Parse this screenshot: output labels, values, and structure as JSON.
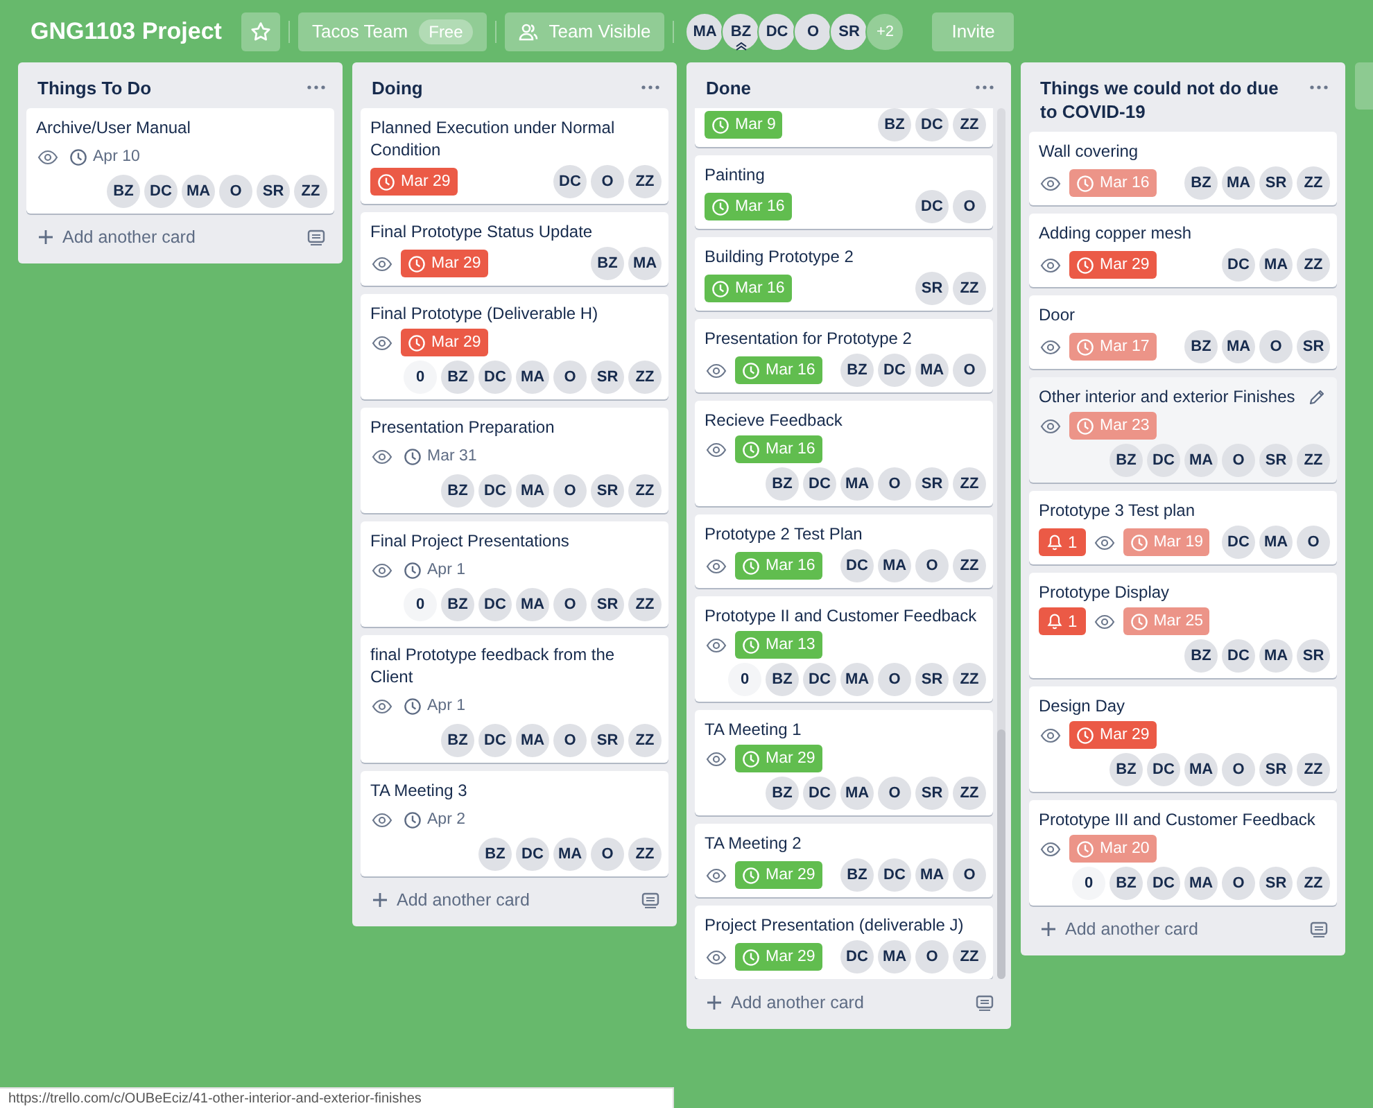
{
  "board": {
    "title": "GNG1103 Project",
    "team": "Tacos Team",
    "plan": "Free",
    "visibility": "Team Visible",
    "members": [
      {
        "initials": "MA",
        "admin": false
      },
      {
        "initials": "BZ",
        "admin": true
      },
      {
        "initials": "DC",
        "admin": false
      },
      {
        "initials": "O",
        "admin": false
      },
      {
        "initials": "SR",
        "admin": false
      }
    ],
    "more_members": "+2",
    "invite": "Invite"
  },
  "lists": [
    {
      "title": "Things To Do",
      "add_card": "Add another card",
      "scrollbar": false,
      "cards": [
        {
          "title": "Archive/User Manual",
          "watching": true,
          "due": {
            "text": "Apr 10",
            "kind": "plain"
          },
          "members": [
            "BZ",
            "DC",
            "MA",
            "O",
            "SR",
            "ZZ"
          ],
          "hovered": false
        }
      ]
    },
    {
      "title": "Doing",
      "add_card": "Add another card",
      "scrollbar": false,
      "cards": [
        {
          "title": "Planned Execution under Normal Condition",
          "watching": false,
          "due": {
            "text": "Mar 29",
            "kind": "overdue"
          },
          "members": [
            "DC",
            "O",
            "ZZ"
          ],
          "hovered": false
        },
        {
          "title": "Final Prototype Status Update",
          "watching": true,
          "due": {
            "text": "Mar 29",
            "kind": "overdue"
          },
          "members": [
            "BZ",
            "MA"
          ],
          "hovered": false
        },
        {
          "title": "Final Prototype (Deliverable H)",
          "watching": true,
          "due": {
            "text": "Mar 29",
            "kind": "overdue"
          },
          "count_badge": "0",
          "members": [
            "BZ",
            "DC",
            "MA",
            "O",
            "SR",
            "ZZ"
          ],
          "hovered": false
        },
        {
          "title": "Presentation Preparation",
          "watching": true,
          "due": {
            "text": "Mar 31",
            "kind": "plain"
          },
          "members": [
            "BZ",
            "DC",
            "MA",
            "O",
            "SR",
            "ZZ"
          ],
          "hovered": false
        },
        {
          "title": "Final Project Presentations",
          "watching": true,
          "due": {
            "text": "Apr 1",
            "kind": "plain"
          },
          "count_badge": "0",
          "members": [
            "BZ",
            "DC",
            "MA",
            "O",
            "SR",
            "ZZ"
          ],
          "hovered": false
        },
        {
          "title": "final Prototype feedback from the Client",
          "watching": true,
          "due": {
            "text": "Apr 1",
            "kind": "plain"
          },
          "members": [
            "BZ",
            "DC",
            "MA",
            "O",
            "SR",
            "ZZ"
          ],
          "hovered": false
        },
        {
          "title": "TA Meeting 3",
          "watching": true,
          "due": {
            "text": "Apr 2",
            "kind": "plain"
          },
          "members": [
            "BZ",
            "DC",
            "MA",
            "O",
            "ZZ"
          ],
          "hovered": false
        }
      ]
    },
    {
      "title": "Done",
      "add_card": "Add another card",
      "scrollbar": true,
      "cards": [
        {
          "watching": false,
          "due": {
            "text": "Mar 9",
            "kind": "complete"
          },
          "members": [
            "BZ",
            "DC",
            "ZZ"
          ],
          "hovered": false
        },
        {
          "title": "Painting",
          "watching": false,
          "due": {
            "text": "Mar 16",
            "kind": "complete"
          },
          "members": [
            "DC",
            "O"
          ],
          "hovered": false
        },
        {
          "title": "Building Prototype 2",
          "watching": false,
          "due": {
            "text": "Mar 16",
            "kind": "complete"
          },
          "members": [
            "SR",
            "ZZ"
          ],
          "hovered": false
        },
        {
          "title": "Presentation for Prototype 2",
          "watching": true,
          "due": {
            "text": "Mar 16",
            "kind": "complete"
          },
          "members": [
            "BZ",
            "DC",
            "MA",
            "O"
          ],
          "hovered": false
        },
        {
          "title": "Recieve Feedback",
          "watching": true,
          "due": {
            "text": "Mar 16",
            "kind": "complete"
          },
          "members": [
            "BZ",
            "DC",
            "MA",
            "O",
            "SR",
            "ZZ"
          ],
          "hovered": false
        },
        {
          "title": "Prototype 2 Test Plan",
          "watching": true,
          "due": {
            "text": "Mar 16",
            "kind": "complete"
          },
          "members": [
            "DC",
            "MA",
            "O",
            "ZZ"
          ],
          "hovered": false
        },
        {
          "title": "Prototype II and Customer Feedback",
          "watching": true,
          "due": {
            "text": "Mar 13",
            "kind": "complete"
          },
          "count_badge": "0",
          "members": [
            "BZ",
            "DC",
            "MA",
            "O",
            "SR",
            "ZZ"
          ],
          "hovered": false
        },
        {
          "title": "TA Meeting 1",
          "watching": true,
          "due": {
            "text": "Mar 29",
            "kind": "complete"
          },
          "members": [
            "BZ",
            "DC",
            "MA",
            "O",
            "SR",
            "ZZ"
          ],
          "hovered": false
        },
        {
          "title": "TA Meeting 2",
          "watching": true,
          "due": {
            "text": "Mar 29",
            "kind": "complete"
          },
          "members": [
            "BZ",
            "DC",
            "MA",
            "O"
          ],
          "hovered": false
        },
        {
          "title": "Project Presentation (deliverable J)",
          "watching": true,
          "due": {
            "text": "Mar 29",
            "kind": "complete"
          },
          "members": [
            "DC",
            "MA",
            "O",
            "ZZ"
          ],
          "hovered": false
        }
      ]
    },
    {
      "title": "Things we could not do due to COVID-19",
      "add_card": "Add another card",
      "scrollbar": false,
      "cards": [
        {
          "title": "Wall covering",
          "watching": true,
          "due": {
            "text": "Mar 16",
            "kind": "overdue_faded"
          },
          "members": [
            "BZ",
            "MA",
            "SR",
            "ZZ"
          ],
          "hovered": false
        },
        {
          "title": "Adding copper mesh",
          "watching": true,
          "due": {
            "text": "Mar 29",
            "kind": "overdue"
          },
          "members": [
            "DC",
            "MA",
            "ZZ"
          ],
          "hovered": false
        },
        {
          "title": "Door",
          "watching": true,
          "due": {
            "text": "Mar 17",
            "kind": "overdue_faded"
          },
          "members": [
            "BZ",
            "MA",
            "O",
            "SR"
          ],
          "hovered": false
        },
        {
          "title": "Other interior and exterior Finishes",
          "watching": true,
          "due": {
            "text": "Mar 23",
            "kind": "overdue_faded"
          },
          "members": [
            "BZ",
            "DC",
            "MA",
            "O",
            "SR",
            "ZZ"
          ],
          "hovered": true
        },
        {
          "title": "Prototype 3 Test plan",
          "notifications": "1",
          "watching": true,
          "due": {
            "text": "Mar 19",
            "kind": "overdue_faded"
          },
          "members": [
            "DC",
            "MA",
            "O"
          ],
          "hovered": false
        },
        {
          "title": "Prototype Display",
          "notifications": "1",
          "watching": true,
          "due": {
            "text": "Mar 25",
            "kind": "overdue_faded"
          },
          "members": [
            "BZ",
            "DC",
            "MA",
            "SR"
          ],
          "hovered": false
        },
        {
          "title": "Design Day",
          "watching": true,
          "due": {
            "text": "Mar 29",
            "kind": "overdue"
          },
          "members": [
            "BZ",
            "DC",
            "MA",
            "O",
            "SR",
            "ZZ"
          ],
          "hovered": false
        },
        {
          "title": "Prototype III and Customer Feedback",
          "watching": true,
          "due": {
            "text": "Mar 20",
            "kind": "overdue_faded"
          },
          "count_badge": "0",
          "members": [
            "BZ",
            "DC",
            "MA",
            "O",
            "SR",
            "ZZ"
          ],
          "hovered": false
        }
      ]
    }
  ],
  "status_url": "https://trello.com/c/OUBeEciz/41-other-interior-and-exterior-finishes"
}
